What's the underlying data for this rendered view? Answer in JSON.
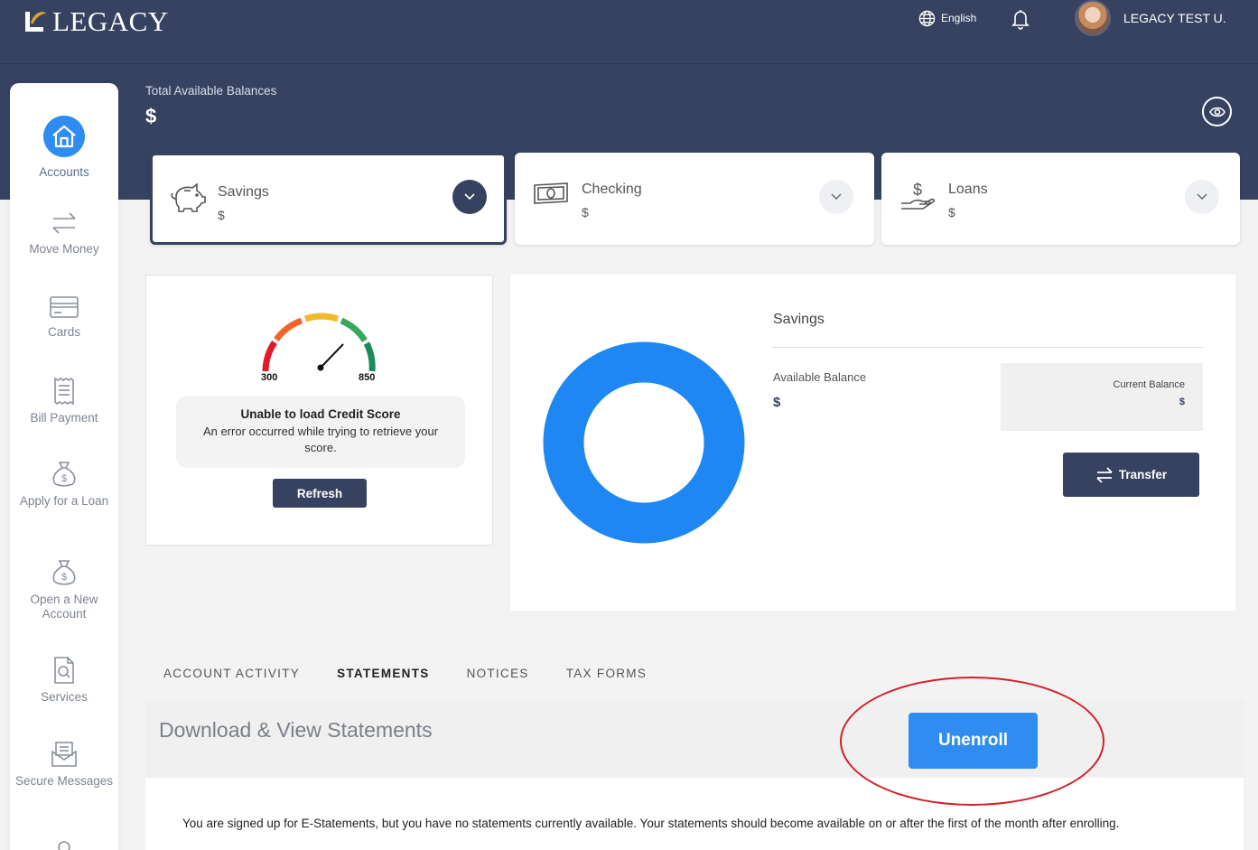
{
  "header": {
    "logo_text": "LEGACY",
    "language_label": "English",
    "username": "LEGACY TEST U."
  },
  "sidebar": {
    "items": [
      {
        "label": "Accounts",
        "icon": "home-icon",
        "active": true
      },
      {
        "label": "Move Money",
        "icon": "arrows-swap-icon"
      },
      {
        "label": "Cards",
        "icon": "card-icon"
      },
      {
        "label": "Bill Payment",
        "icon": "receipt-icon"
      },
      {
        "label": "Apply for a Loan",
        "icon": "money-bag-icon"
      },
      {
        "label": "Open a New Account",
        "icon": "money-bag-icon"
      },
      {
        "label": "Services",
        "icon": "document-search-icon"
      },
      {
        "label": "Secure Messages",
        "icon": "envelope-icon"
      }
    ]
  },
  "balances": {
    "total_label": "Total Available Balances",
    "total_value": "$"
  },
  "accounts": [
    {
      "name": "Savings",
      "amount": "$",
      "icon": "piggy-bank-icon",
      "selected": true
    },
    {
      "name": "Checking",
      "amount": "$",
      "icon": "banknote-icon",
      "selected": false
    },
    {
      "name": "Loans",
      "amount": "$",
      "icon": "hand-dollar-icon",
      "selected": false
    }
  ],
  "credit": {
    "min_label": "300",
    "max_label": "850",
    "error_title": "Unable to load Credit Score",
    "error_message": "An error occurred while trying to retrieve your score.",
    "refresh_label": "Refresh"
  },
  "detail": {
    "title": "Savings",
    "available_label": "Available Balance",
    "available_value": "$",
    "current_label": "Current Balance",
    "current_value": "$",
    "transfer_label": "Transfer",
    "donut_color": "#1f87f3"
  },
  "tabs": [
    {
      "label": "ACCOUNT ACTIVITY",
      "active": false
    },
    {
      "label": "STATEMENTS",
      "active": true
    },
    {
      "label": "NOTICES",
      "active": false
    },
    {
      "label": "TAX FORMS",
      "active": false
    }
  ],
  "statements": {
    "title": "Download & View Statements",
    "unenroll_label": "Unenroll",
    "message": "You are signed up for E-Statements, but you have no statements currently available. Your statements should become available on or after the first of the month after enrolling."
  },
  "colors": {
    "navy": "#364260",
    "accent_blue": "#2f8cf0",
    "annotation_red": "#d21f26"
  }
}
